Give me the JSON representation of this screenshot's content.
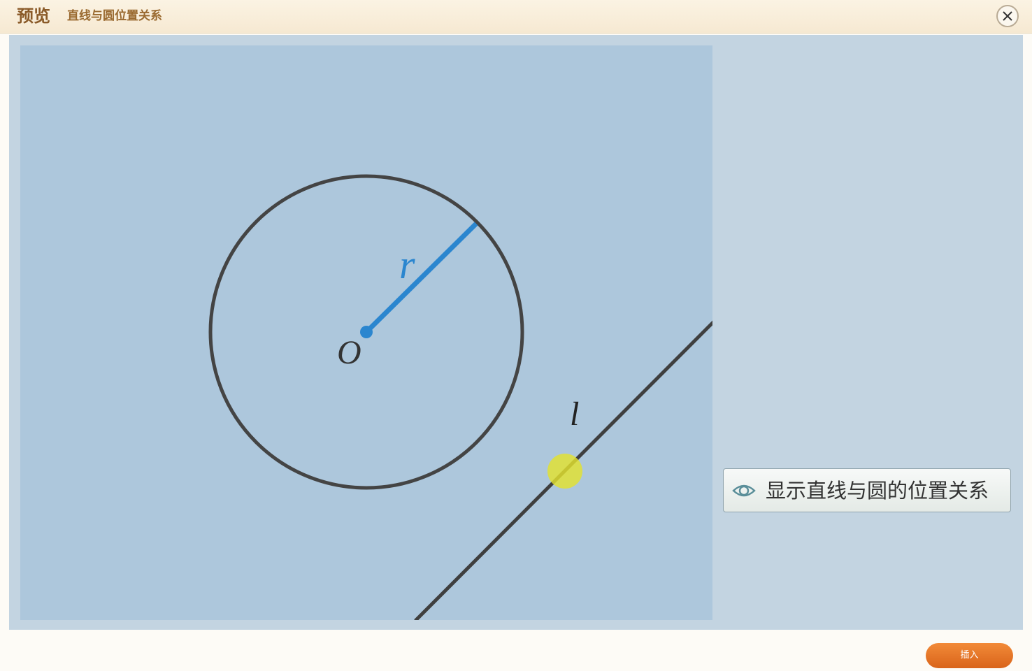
{
  "window": {
    "title": "预览",
    "subtitle": "直线与圆位置关系"
  },
  "figure": {
    "center_label": "O",
    "radius_label": "r",
    "line_label": "l"
  },
  "controls": {
    "show_relation_label": "显示直线与圆的位置关系",
    "insert_label": "插入"
  },
  "colors": {
    "radius": "#2b86cf",
    "circle": "#444444",
    "line": "#3f3f3f",
    "drag_point": "#e3e22e",
    "canvas_bg": "#adc7dc",
    "accent": "#e8731f"
  },
  "icons": {
    "close": "close-icon",
    "eye": "eye-icon"
  }
}
